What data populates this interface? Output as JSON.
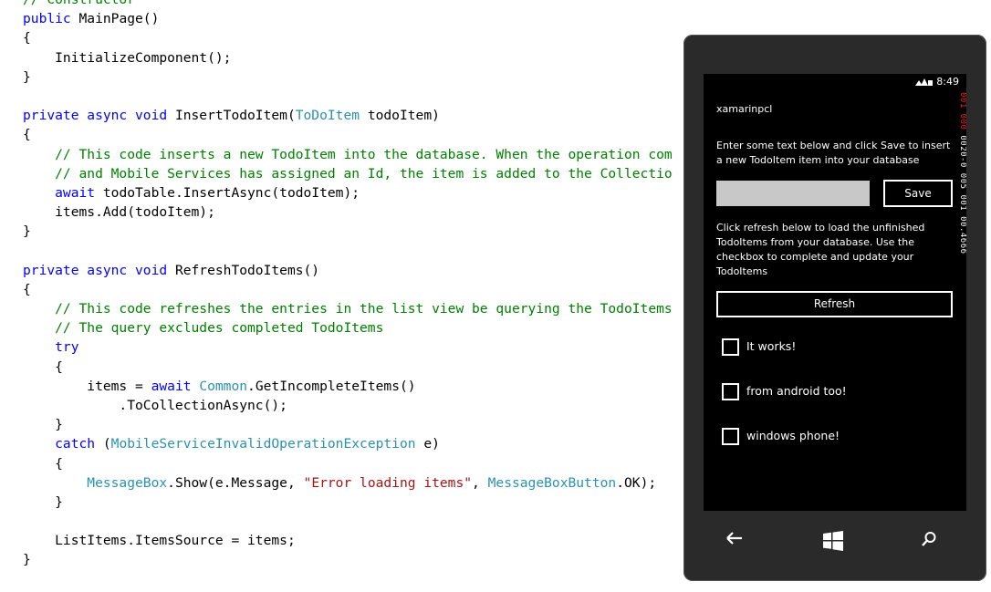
{
  "code": {
    "lines": [
      [
        [
          "cm",
          "// Constructor"
        ]
      ],
      [
        [
          "kw",
          "public"
        ],
        [
          "",
          "MainPage()"
        ]
      ],
      [
        [
          "",
          "{"
        ]
      ],
      [
        [
          "",
          "    InitializeComponent();"
        ]
      ],
      [
        [
          "",
          "}"
        ]
      ],
      [
        [
          "",
          ""
        ]
      ],
      [
        [
          "kw",
          "private async void"
        ],
        [
          "",
          "InsertTodoItem("
        ],
        [
          "typ",
          "ToDoItem"
        ],
        [
          "",
          " todoItem)"
        ]
      ],
      [
        [
          "",
          "{"
        ]
      ],
      [
        [
          "cm",
          "    // This code inserts a new TodoItem into the database. When the operation com"
        ]
      ],
      [
        [
          "cm",
          "    // and Mobile Services has assigned an Id, the item is added to the Collectio"
        ]
      ],
      [
        [
          "kw",
          "    await"
        ],
        [
          "",
          "todoTable.InsertAsync(todoItem);"
        ]
      ],
      [
        [
          "",
          "    items.Add(todoItem);"
        ]
      ],
      [
        [
          "",
          "}"
        ]
      ],
      [
        [
          "",
          ""
        ]
      ],
      [
        [
          "kw",
          "private async void"
        ],
        [
          "",
          "RefreshTodoItems()"
        ]
      ],
      [
        [
          "",
          "{"
        ]
      ],
      [
        [
          "cm",
          "    // This code refreshes the entries in the list view be querying the TodoItems"
        ]
      ],
      [
        [
          "cm",
          "    // The query excludes completed TodoItems"
        ]
      ],
      [
        [
          "kw",
          "    try"
        ]
      ],
      [
        [
          "",
          "    {"
        ]
      ],
      [
        [
          "",
          "        items = "
        ],
        [
          "kw",
          "await"
        ],
        [
          "",
          " "
        ],
        [
          "typ",
          "Common"
        ],
        [
          "",
          ".GetIncompleteItems()"
        ]
      ],
      [
        [
          "",
          "            .ToCollectionAsync();"
        ]
      ],
      [
        [
          "",
          "    }"
        ]
      ],
      [
        [
          "kw",
          "    catch"
        ],
        [
          "",
          " ("
        ],
        [
          "typ",
          "MobileServiceInvalidOperationException"
        ],
        [
          "",
          " e)"
        ]
      ],
      [
        [
          "",
          "    {"
        ]
      ],
      [
        [
          "typ",
          "        MessageBox"
        ],
        [
          "",
          ".Show(e.Message, "
        ],
        [
          "str",
          "\"Error loading items\""
        ],
        [
          "",
          ", "
        ],
        [
          "typ",
          "MessageBoxButton"
        ],
        [
          "",
          ".OK);"
        ]
      ],
      [
        [
          "",
          "    }"
        ]
      ],
      [
        [
          "",
          ""
        ]
      ],
      [
        [
          "",
          "    ListItems.ItemsSource = items;"
        ]
      ],
      [
        [
          "",
          "}"
        ]
      ]
    ]
  },
  "phone": {
    "status": {
      "time": "8:49",
      "debug_red": "001 000",
      "debug_white": " 0020-0 005 001 00.4666"
    },
    "app_title": "xamarinpcl",
    "instructions_save": "Enter some text below and click Save to insert a new TodoItem item into your database",
    "input_value": "",
    "save_label": "Save",
    "instructions_refresh": "Click refresh below to load the unfinished TodoItems from your database. Use the checkbox to complete and update your TodoItems",
    "refresh_label": "Refresh",
    "todo_items": [
      {
        "label": "It works!",
        "checked": false
      },
      {
        "label": "from android too!",
        "checked": false
      },
      {
        "label": "windows phone!",
        "checked": false
      }
    ],
    "nav": {
      "back_icon": "arrow-left-icon",
      "start_icon": "windows-logo-icon",
      "search_icon": "search-icon"
    }
  }
}
